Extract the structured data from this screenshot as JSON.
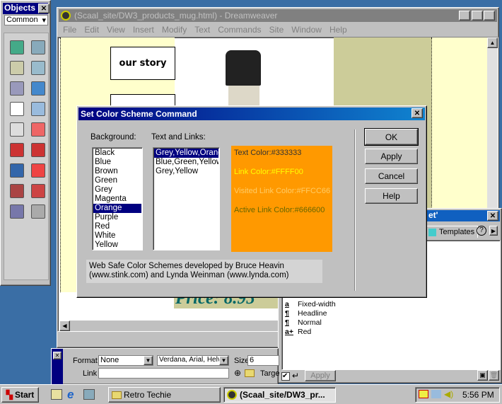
{
  "objects_panel": {
    "title": "Objects",
    "category": "Common",
    "icons": [
      "image-icon",
      "rollover-image-icon",
      "table-icon",
      "tabular-data-icon",
      "horizontal-rule-icon",
      "navigation-bar-icon",
      "layer-icon",
      "line-break-icon",
      "email-link-icon",
      "date-icon",
      "flash-icon",
      "fireworks-icon",
      "shockwave-icon",
      "generator-icon",
      "applet-icon",
      "activex-icon",
      "plugin-icon",
      "server-side-include-icon"
    ]
  },
  "window": {
    "title": "(Scaal_site/DW3_products_mug.html) - Dreamweaver",
    "menu": [
      "File",
      "Edit",
      "View",
      "Insert",
      "Modify",
      "Text",
      "Commands",
      "Site",
      "Window",
      "Help"
    ]
  },
  "document": {
    "nav_label": "our story",
    "price": "Price: 8.95"
  },
  "dialog": {
    "title": "Set Color Scheme Command",
    "background_label": "Background:",
    "text_links_label": "Text and Links:",
    "backgrounds": [
      "Black",
      "Blue",
      "Brown",
      "Green",
      "Grey",
      "Magenta",
      "Orange",
      "Purple",
      "Red",
      "White",
      "Yellow"
    ],
    "selected_background": "Orange",
    "schemes": [
      "Grey,Yellow,Orange",
      "Blue,Green,Yellow",
      "Grey,Yellow"
    ],
    "selected_scheme": "Grey,Yellow,Orange",
    "preview": {
      "bg": "#FF9900",
      "text": "Text Color:#333333",
      "link": "Link Color:#FFFF00",
      "visited": "Visited Link Color:#FFCC66",
      "active": "Active Link Color:#666600"
    },
    "credits_line1": "Web Safe Color Schemes developed by Bruce Heavin",
    "credits_line2": "(www.stink.com) and Lynda Weinman (www.lynda.com)",
    "buttons": {
      "ok": "OK",
      "apply": "Apply",
      "cancel": "Cancel",
      "help": "Help"
    }
  },
  "styles_panel": {
    "title_fragment": "et'",
    "tab": "Templates",
    "items": [
      {
        "icon": "a",
        "label": "Fixed-width"
      },
      {
        "icon": "¶",
        "label": "Headline"
      },
      {
        "icon": "¶",
        "label": "Normal"
      },
      {
        "icon": "a+",
        "label": "Red"
      }
    ],
    "apply": "Apply"
  },
  "properties": {
    "format_label": "Format",
    "format": "None",
    "font": "Verdana, Arial, Helv",
    "size_label": "Size",
    "size": "6",
    "link_label": "Link",
    "link": "",
    "target_label": "Targe"
  },
  "taskbar": {
    "start": "Start",
    "tasks": [
      "Retro Techie",
      "(Scaal_site/DW3_pr..."
    ],
    "clock": "5:56 PM"
  }
}
